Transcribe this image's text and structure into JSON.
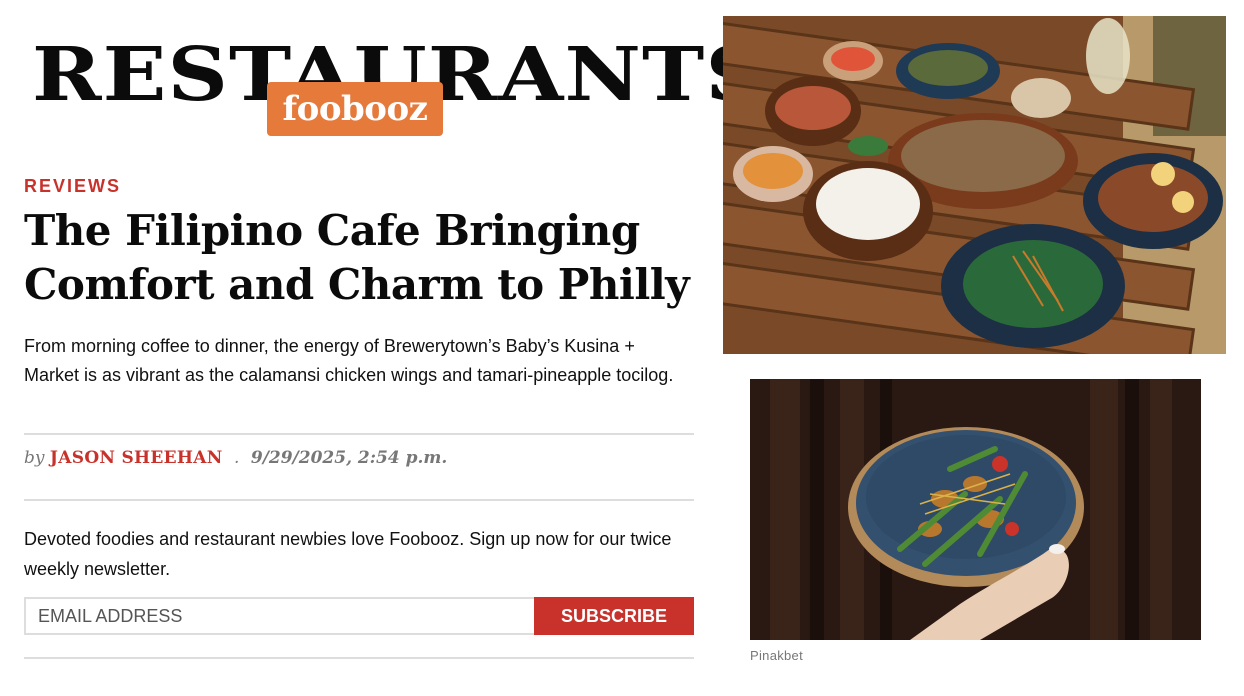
{
  "masthead": {
    "section_title": "RESTAURANTS",
    "brand": "foobooz"
  },
  "article": {
    "kicker": "REVIEWS",
    "headline": "The Filipino Cafe Bringing Comfort and Charm to Philly",
    "dek": "From morning coffee to dinner, the energy of Brewerytown’s Baby’s Kusina + Market is as vibrant as the calamansi chicken wings and tamari-pineapple tocilog.",
    "byline_prefix": "by",
    "author": "JASON SHEEHAN",
    "byline_sep": ".",
    "date": "9/29/2025, 2:54 p.m."
  },
  "newsletter": {
    "text": "Devoted foodies and restaurant newbies love Foobooz. Sign up now for our twice weekly newsletter.",
    "email_placeholder": "EMAIL ADDRESS",
    "subscribe_label": "SUBSCRIBE"
  },
  "photos": {
    "bottom_caption": "Pinakbet"
  },
  "colors": {
    "accent_red": "#c8322b",
    "brand_orange": "#e57a3a"
  }
}
